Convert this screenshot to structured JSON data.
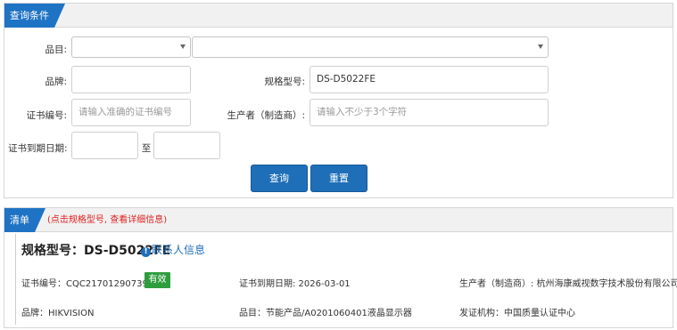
{
  "query_panel": {
    "tab_label": "查询条件",
    "category": {
      "label": "品目:",
      "value_primary": "",
      "value_secondary": ""
    },
    "brand": {
      "label": "品牌:",
      "value": ""
    },
    "model": {
      "label": "规格型号:",
      "value": "DS-D5022FE"
    },
    "cert_no": {
      "label": "证书编号:",
      "placeholder": "请输入准确的证书编号"
    },
    "manufacturer": {
      "label": "生产者（制造商）:",
      "placeholder": "请输入不少于3个字符"
    },
    "expiry": {
      "label": "证书到期日期:",
      "from": "",
      "to_label": "至",
      "to": ""
    },
    "buttons": {
      "search": "查询",
      "reset": "重置"
    }
  },
  "list_panel": {
    "tab_label": "清单",
    "hint": "(点击规格型号, 查看详细信息)",
    "item": {
      "model_title": "规格型号：DS-D5022FE",
      "contact_icon": "info-icon",
      "contact_label": "联系人信息",
      "cert_no": "证书编号：CQC21701290739",
      "status": "有效",
      "expiry": "证书到期日期: 2026-03-01",
      "manufacturer": "生产者（制造商）: 杭州海康威视数字技术股份有限公司",
      "brand": "品牌：HIKVISION",
      "category": "品目：节能产品/A0201060401液晶显示器",
      "issuer": "发证机构：中国质量认证中心"
    }
  },
  "colors": {
    "accent": "#1f73c4",
    "hint": "#e02020",
    "status_valid": "#2e9d3e"
  }
}
